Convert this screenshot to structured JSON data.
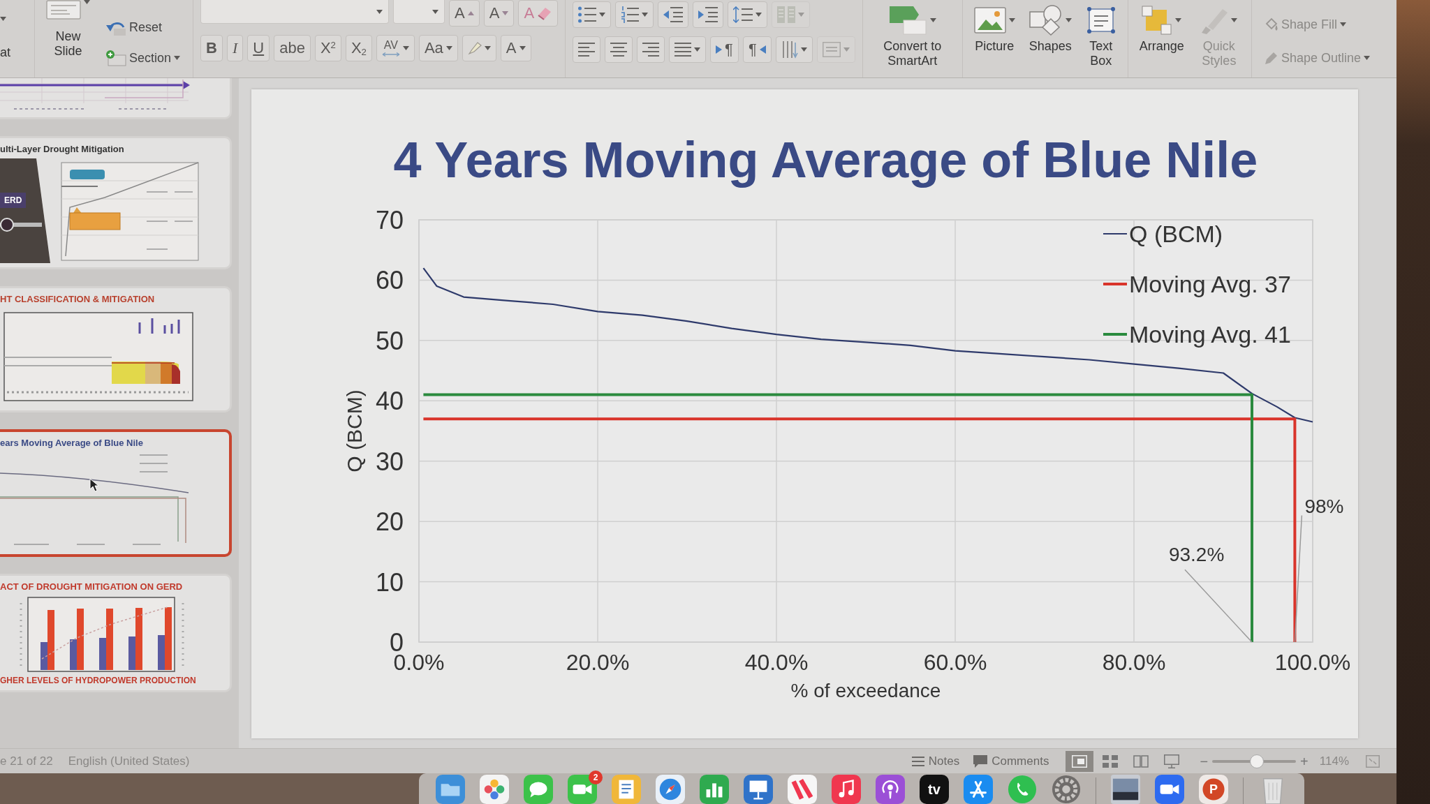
{
  "ribbon": {
    "edge_label": "at",
    "new_slide": {
      "label": "New Slide"
    },
    "slide_actions": [
      {
        "kind": "reset",
        "label": "Reset"
      },
      {
        "kind": "section",
        "label": "Section"
      }
    ],
    "font_rows": [
      [
        {
          "kind": "font-name"
        },
        {
          "kind": "font-size"
        },
        {
          "kind": "grow",
          "label": "A"
        },
        {
          "kind": "shrink",
          "label": "A"
        },
        {
          "kind": "clear",
          "label": "A"
        }
      ],
      [
        {
          "kind": "bold",
          "label": "B"
        },
        {
          "kind": "italic",
          "label": "I"
        },
        {
          "kind": "underline",
          "label": "U"
        },
        {
          "kind": "strike",
          "label": "abe"
        },
        {
          "kind": "superscript",
          "label": "X$^{2}$"
        },
        {
          "kind": "subscript",
          "label": "X$_{2}$"
        },
        {
          "kind": "spacing",
          "label": "AV"
        },
        {
          "kind": "case",
          "label": "Aa"
        },
        {
          "kind": "highlight"
        },
        {
          "kind": "font-color",
          "label": "A"
        }
      ]
    ],
    "paragraph_rows": [
      [
        {
          "kind": "bullets",
          "disabled": false
        },
        {
          "kind": "numbering",
          "disabled": false
        },
        {
          "kind": "outdent",
          "disabled": false
        },
        {
          "kind": "indent",
          "disabled": false
        },
        {
          "kind": "line-spacing",
          "disabled": false
        },
        {
          "kind": "columns",
          "disabled": true
        }
      ],
      [
        {
          "kind": "align-left",
          "disabled": false
        },
        {
          "kind": "align-center",
          "disabled": false
        },
        {
          "kind": "align-right",
          "disabled": false
        },
        {
          "kind": "justify",
          "disabled": false
        },
        {
          "kind": "ltr",
          "label": "¶",
          "disabled": false
        },
        {
          "kind": "rtl",
          "label": "¶",
          "disabled": false
        },
        {
          "kind": "text-direction",
          "disabled": false
        },
        {
          "kind": "align-text",
          "disabled": true
        }
      ]
    ],
    "convert": {
      "kind": "smartart",
      "label": "Convert to SmartArt",
      "disabled": false
    },
    "insert_buttons": [
      {
        "kind": "picture",
        "label": "Picture",
        "disabled": false
      },
      {
        "kind": "shapes",
        "label": "Shapes",
        "disabled": false
      },
      {
        "kind": "textbox",
        "label": "Text Box",
        "disabled": false
      }
    ],
    "drawing_buttons": [
      {
        "kind": "arrange",
        "label": "Arrange",
        "disabled": false
      },
      {
        "kind": "quick-styles",
        "label": "Quick Styles",
        "disabled": true
      }
    ],
    "shape_format": [
      {
        "kind": "fill",
        "label": "Shape Fill",
        "disabled": true
      },
      {
        "kind": "outline",
        "label": "Shape Outline",
        "disabled": true
      }
    ]
  },
  "thumbnails": [
    {
      "kind": "line",
      "selected": false
    },
    {
      "kind": "dam",
      "title": "ulti-Layer Drought Mitigation",
      "tag": "ERD",
      "selected": false
    },
    {
      "kind": "area",
      "title": "HT CLASSIFICATION & MITIGATION",
      "selected": false
    },
    {
      "kind": "moving",
      "title": "ears Moving Average of Blue Nile",
      "selected": true
    },
    {
      "kind": "bars",
      "title": "ACT OF DROUGHT MITIGATION ON GERD",
      "footer": "GHER LEVELS OF HYDROPOWER PRODUCTION",
      "selected": false
    }
  ],
  "slide": {
    "title": "4 Years Moving Average of Blue Nile",
    "chart_data": {
      "type": "line",
      "xlabel": "% of exceedance",
      "ylabel": "Q (BCM)",
      "xlim": [
        0,
        1
      ],
      "ylim": [
        0,
        70
      ],
      "grid": true,
      "legend": true,
      "xticks": [
        {
          "value": 0,
          "label": "0.0%"
        },
        {
          "value": 0.2,
          "label": "20.0%"
        },
        {
          "value": 0.4,
          "label": "40.0%"
        },
        {
          "value": 0.6,
          "label": "60.0%"
        },
        {
          "value": 0.8,
          "label": "80.0%"
        },
        {
          "value": 1,
          "label": "100.0%"
        }
      ],
      "yticks": [
        0,
        10,
        20,
        30,
        40,
        50,
        60,
        70
      ],
      "series": [
        {
          "name": "Q (BCM)",
          "color": "#2e3a6b",
          "x": [
            0.005,
            0.02,
            0.05,
            0.1,
            0.15,
            0.2,
            0.25,
            0.3,
            0.35,
            0.4,
            0.45,
            0.5,
            0.55,
            0.6,
            0.65,
            0.7,
            0.75,
            0.8,
            0.85,
            0.9,
            0.932,
            0.96,
            0.98,
            1.0
          ],
          "values": [
            62,
            59,
            57.2,
            56.6,
            56,
            54.8,
            54.2,
            53.2,
            52,
            51,
            50.2,
            49.7,
            49.2,
            48.3,
            47.8,
            47.3,
            46.8,
            46.1,
            45.4,
            44.6,
            41.2,
            39,
            37.2,
            36.5
          ]
        },
        {
          "name": "Moving Avg. 37",
          "color": "#d9342b",
          "x": [
            0.005,
            0.98,
            0.98
          ],
          "values": [
            37,
            37,
            0
          ]
        },
        {
          "name": "Moving Avg. 41",
          "color": "#2a8a3e",
          "x": [
            0.005,
            0.932,
            0.932
          ],
          "values": [
            41,
            41,
            0
          ]
        }
      ],
      "annotations": [
        {
          "text": "93.2%",
          "x": 0.932,
          "y": 0
        },
        {
          "text": "98%",
          "x": 0.98,
          "y": 0
        }
      ]
    }
  },
  "status_bar": {
    "slide_count": "e 21 of 22",
    "language": "English (United States)",
    "buttons": [
      {
        "kind": "notes",
        "label": "Notes"
      },
      {
        "kind": "comments",
        "label": "Comments"
      }
    ],
    "views": [
      {
        "kind": "normal",
        "selected": true
      },
      {
        "kind": "sorter",
        "selected": false
      },
      {
        "kind": "reading",
        "selected": false
      },
      {
        "kind": "slideshow",
        "selected": false
      }
    ],
    "zoom": {
      "out": "−",
      "in": "+",
      "level": 0.53,
      "reading": "114%"
    }
  },
  "dock": {
    "apps": [
      {
        "kind": "folder"
      },
      {
        "kind": "flower"
      },
      {
        "kind": "chat"
      },
      {
        "kind": "camera",
        "badge": "2"
      },
      {
        "kind": "document"
      },
      {
        "kind": "compass"
      },
      {
        "kind": "chart"
      },
      {
        "kind": "podium"
      },
      {
        "kind": "stripes"
      },
      {
        "kind": "music"
      },
      {
        "kind": "podcast"
      },
      {
        "kind": "tv",
        "label": "tv"
      },
      {
        "kind": "store"
      },
      {
        "kind": "phone"
      },
      {
        "kind": "gear"
      },
      {
        "kind": "separator"
      },
      {
        "kind": "photo"
      },
      {
        "kind": "video"
      },
      {
        "kind": "slides",
        "label": "P"
      },
      {
        "kind": "separator"
      },
      {
        "kind": "trash"
      }
    ]
  }
}
